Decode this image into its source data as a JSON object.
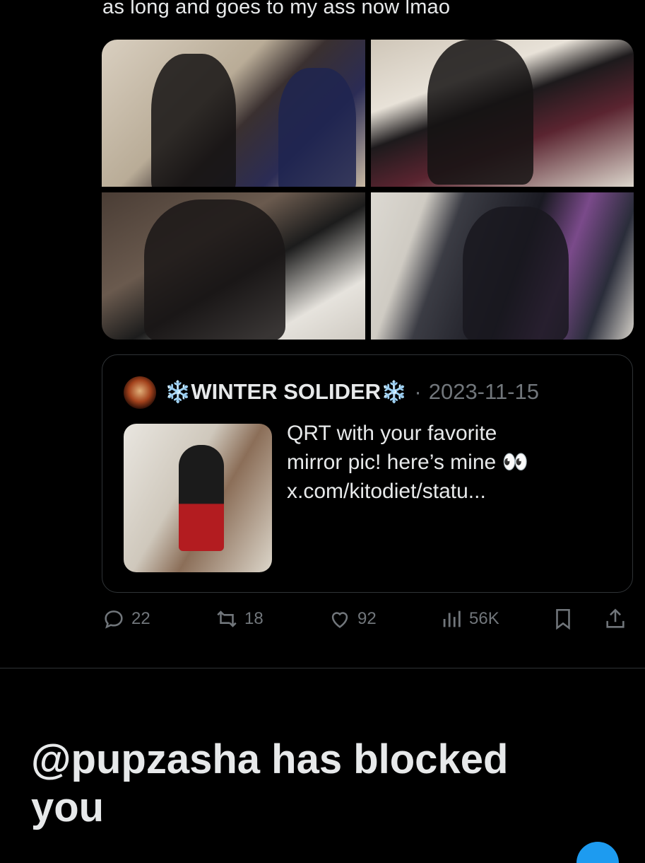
{
  "tweet": {
    "text": "as long and goes to my ass now lmao"
  },
  "media": {
    "photos": [
      {
        "alt_name": "photo-1"
      },
      {
        "alt_name": "photo-2"
      },
      {
        "alt_name": "photo-3"
      },
      {
        "alt_name": "photo-4"
      }
    ]
  },
  "quote": {
    "snowflake": "❄️",
    "name": "WINTER SOLIDER",
    "separator": "·",
    "date": "2023-11-15",
    "text_line1": "QRT with your favorite",
    "text_line2": "mirror pic! here’s mine 👀",
    "text_line3": "x.com/kitodiet/statu..."
  },
  "actions": {
    "replies": "22",
    "retweets": "18",
    "likes": "92",
    "views": "56K"
  },
  "blocked_message": {
    "line1": "@pupzasha has blocked",
    "line2": "you"
  },
  "colors": {
    "background": "#000000",
    "text": "#e7e9ea",
    "muted": "#71767b",
    "border": "#2f3336",
    "accent": "#1d9bf0"
  }
}
